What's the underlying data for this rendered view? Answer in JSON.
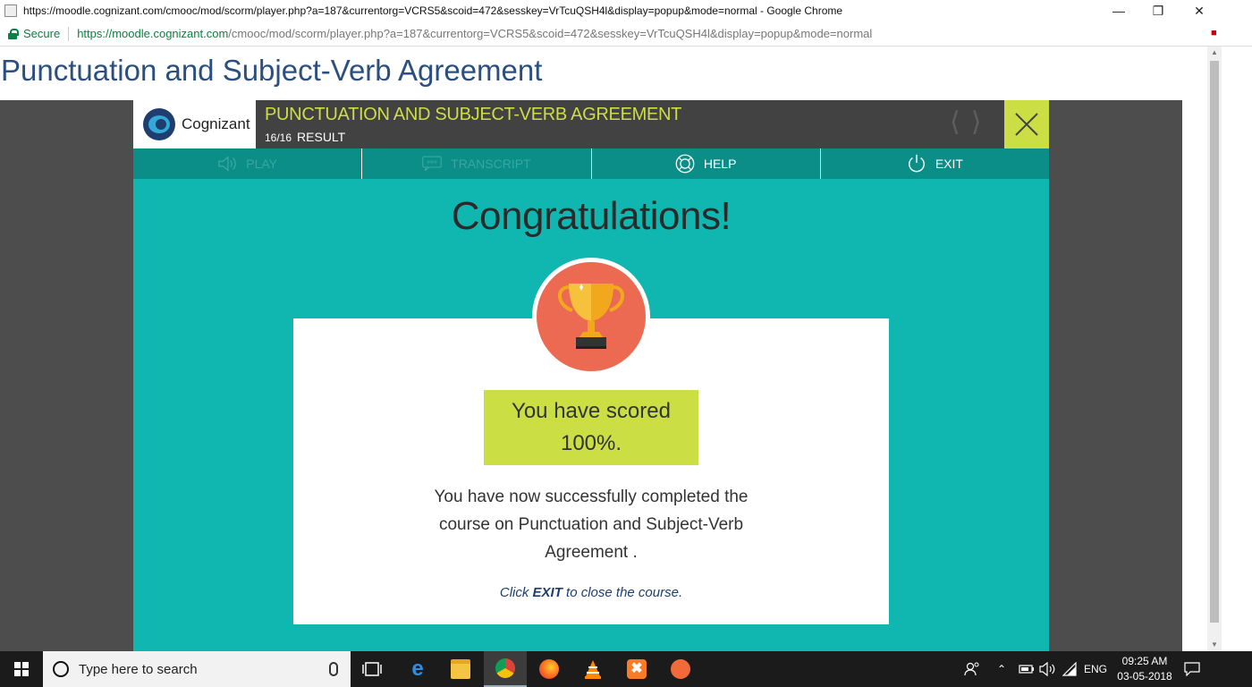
{
  "window": {
    "title": "https://moodle.cognizant.com/cmooc/mod/scorm/player.php?a=187&currentorg=VCRS5&scoid=472&sesskey=VrTcuQSH4l&display=popup&mode=normal - Google Chrome",
    "minimize": "—",
    "restore": "❐",
    "close": "✕"
  },
  "address_bar": {
    "secure_label": "Secure",
    "url_host": "https://moodle.cognizant.com",
    "url_path": "/cmooc/mod/scorm/player.php?a=187&currentorg=VCRS5&scoid=472&sesskey=VrTcuQSH4l&display=popup&mode=normal"
  },
  "page": {
    "heading": "Punctuation and Subject-Verb Agreement"
  },
  "player": {
    "brand": "Cognizant",
    "course_title": "PUNCTUATION AND SUBJECT-VERB AGREEMENT",
    "progress": "16/16",
    "section": "RESULT",
    "toolbar": {
      "play": "PLAY",
      "transcript": "TRANSCRIPT",
      "help": "HELP",
      "exit": "EXIT"
    },
    "result": {
      "heading": "Congratulations!",
      "score_line1": "You have scored",
      "score_line2": "100%.",
      "message": "You have now successfully completed the course on Punctuation and Subject-Verb Agreement .",
      "hint_pre": "Click ",
      "hint_exit": "EXIT",
      "hint_post": " to close the course."
    }
  },
  "colors": {
    "teal": "#10b7b1",
    "dark_teal": "#0b8d88",
    "lime": "#cbdf45",
    "trophy_bg": "#ec6a52",
    "dark_bar": "#424242"
  },
  "taskbar": {
    "search_placeholder": "Type here to search",
    "language": "ENG",
    "time": "09:25 AM",
    "date": "03-05-2018"
  }
}
